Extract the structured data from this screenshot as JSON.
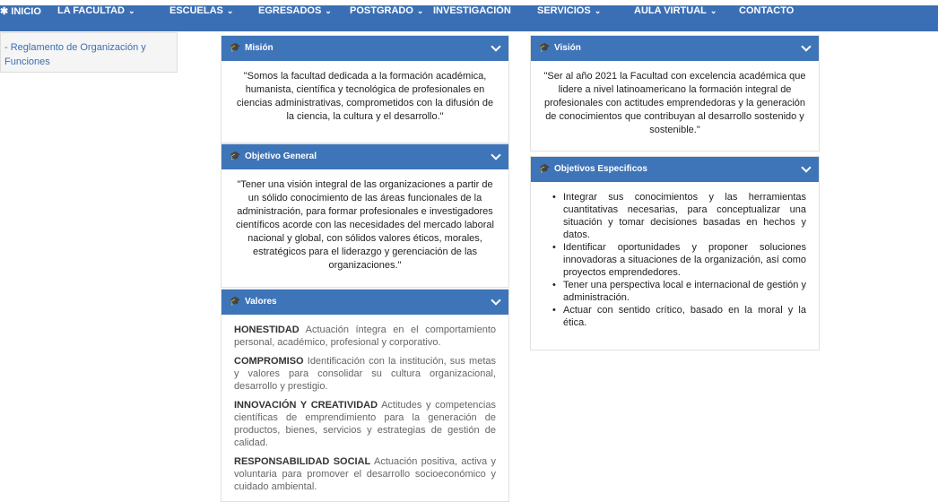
{
  "nav": {
    "items": [
      {
        "label": "INICIO",
        "icon": "home-icon",
        "caret": false
      },
      {
        "label": "LA FACULTAD",
        "caret": true
      },
      {
        "label": "ESCUELAS",
        "caret": true
      },
      {
        "label": "EGRESADOS",
        "caret": true
      },
      {
        "label": "POSTGRADO",
        "caret": true
      },
      {
        "label": "INVESTIGACIÓN",
        "caret": false
      },
      {
        "label": "SERVICIOS",
        "caret": true
      },
      {
        "label": "AULA VIRTUAL",
        "caret": true
      },
      {
        "label": "CONTACTO",
        "caret": false
      }
    ]
  },
  "sidebar": {
    "link": "- Reglamento de Organización y Funciones"
  },
  "mision": {
    "title": "Misión",
    "text": "\"Somos la facultad dedicada a la formación académica, humanista, científica y tecnológica de profesionales en ciencias administrativas, comprometidos con la difusión de la ciencia, la cultura y el desarrollo.\""
  },
  "vision": {
    "title": "Visión",
    "text": "\"Ser al año 2021 la Facultad con excelencia académica que lidere a nivel latinoamericano la formación integral de profesionales con actitudes emprendedoras y la generación de conocimientos que contribuyan al desarrollo sostenido y sostenible.\""
  },
  "objetivo_general": {
    "title": "Objetivo General",
    "text": "\"Tener una visión integral de las organizaciones a partir de un sólido conocimiento de las áreas funcionales de la administración, para formar profesionales e investigadores científicos acorde con las necesidades del mercado laboral nacional y global, con sólidos valores éticos, morales, estratégicos para el liderazgo y gerenciación de las organizaciones.\""
  },
  "objetivos_especificos": {
    "title": "Objetivos Especificos",
    "items": [
      "Integrar sus conocimientos y las herramientas cuantitativas necesarias, para conceptualizar una situación y tomar decisiones basadas en hechos y datos.",
      "Identificar oportunidades y proponer soluciones innovadoras a situaciones de la organización, así como proyectos emprendedores.",
      "Tener una perspectiva local e internacional de gestión y administración.",
      "Actuar con sentido crítico, basado en la moral y la ética."
    ]
  },
  "valores": {
    "title": "Valores",
    "items": [
      {
        "name": "HONESTIDAD",
        "text": " Actuación íntegra en el comportamiento personal, académico, profesional y corporativo."
      },
      {
        "name": "COMPROMISO",
        "text": " Identificación con la institución, sus metas y valores para consolidar su cultura organizacional, desarrollo y prestigio."
      },
      {
        "name": "INNOVACIÓN Y CREATIVIDAD",
        "text": " Actitudes y competencias científicas de emprendimiento para la generación de productos, bienes, servicios y estrategias de gestión de calidad."
      },
      {
        "name": "RESPONSABILIDAD SOCIAL",
        "text": " Actuación positiva, activa y voluntaria para promover el desarrollo socioeconómico y cuidado ambiental."
      }
    ]
  },
  "colors": {
    "nav_bg": "#3a6fb5",
    "panel_head_bg": "#3e74b8",
    "link": "#3a6fb5"
  },
  "icons": {
    "panel_head": "graduation-cap-icon",
    "panel_toggle": "chevron-down-icon",
    "nav_caret": "caret-down-icon"
  }
}
